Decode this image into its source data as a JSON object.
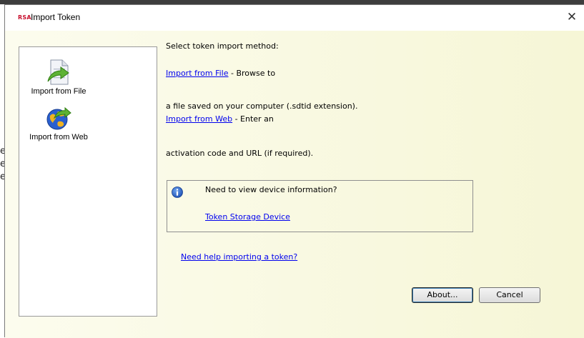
{
  "window": {
    "title": "Import Token",
    "brand": "RSA",
    "close_glyph": "✕"
  },
  "background": {
    "fragments": [
      "e",
      "e",
      "e"
    ]
  },
  "methods": [
    {
      "label": "Import from File",
      "icon": "document-arrow-icon"
    },
    {
      "label": "Import from Web",
      "icon": "globe-arrow-icon"
    }
  ],
  "main": {
    "heading": "Select token import method:",
    "file_link": "Import from File",
    "file_suffix": " - Browse to",
    "file_desc": "a file saved on your computer (.sdtid extension).",
    "web_link": "Import from Web",
    "web_suffix": " - Enter an",
    "web_desc": "activation code and URL (if required)."
  },
  "info": {
    "icon": "info-icon",
    "question": "Need to view device information?",
    "link": "Token Storage Device"
  },
  "help": {
    "link": "Need help importing a token?"
  },
  "buttons": {
    "about": "About...",
    "cancel": "Cancel"
  },
  "colors": {
    "link": "#0000ee",
    "brand": "#c8102e",
    "panel_bg": "#f6f6d6"
  }
}
